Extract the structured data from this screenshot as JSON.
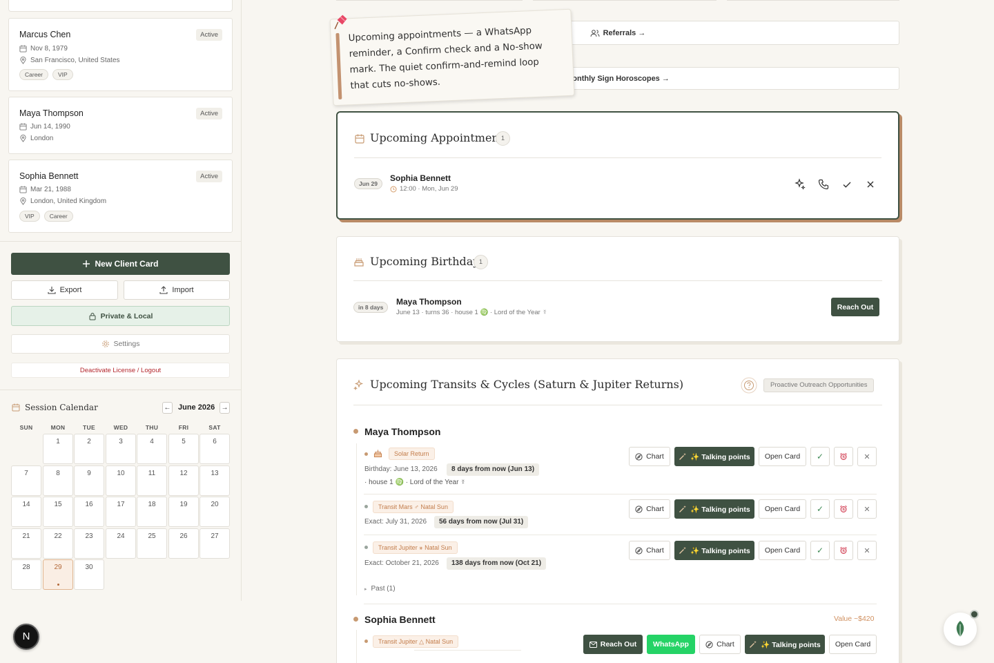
{
  "clients": [
    {
      "name": "Marcus Chen",
      "status": "Active",
      "date": "Nov 8, 1979",
      "location": "San Francisco, United States",
      "tags": [
        "Career",
        "VIP"
      ]
    },
    {
      "name": "Maya Thompson",
      "status": "Active",
      "date": "Jun 14, 1990",
      "location": "London",
      "tags": []
    },
    {
      "name": "Sophia Bennett",
      "status": "Active",
      "date": "Mar 21, 1988",
      "location": "London, United Kingdom",
      "tags": [
        "VIP",
        "Career"
      ]
    }
  ],
  "sidebar": {
    "new_client": "New Client Card",
    "export": "Export",
    "import": "Import",
    "private": "Private & Local",
    "settings": "Settings",
    "logout": "Deactivate License / Logout"
  },
  "calendar": {
    "title": "Session Calendar",
    "month": "June 2026",
    "prev": "←",
    "next": "→",
    "dow": [
      "SUN",
      "MON",
      "TUE",
      "WED",
      "THU",
      "FRI",
      "SAT"
    ],
    "today": "29",
    "days": [
      "1",
      "2",
      "3",
      "4",
      "5",
      "6",
      "7",
      "8",
      "9",
      "10",
      "11",
      "12",
      "13",
      "14",
      "15",
      "16",
      "17",
      "18",
      "19",
      "20",
      "21",
      "22",
      "23",
      "24",
      "25",
      "26",
      "27",
      "28",
      "29",
      "30"
    ]
  },
  "nextjs_badge": "N",
  "links": {
    "referrals": "Referrals →",
    "horoscopes": "Monthly Sign Horoscopes →"
  },
  "note": {
    "text": "Upcoming appointments — a WhatsApp reminder, a Confirm check and a No-show mark. The quiet confirm-and-remind loop that cuts no-shows."
  },
  "appointments": {
    "title": "Upcoming Appointments",
    "count": "1",
    "items": [
      {
        "date": "Jun 29",
        "name": "Sophia Bennett",
        "time": "12:00 · Mon, Jun 29"
      }
    ]
  },
  "birthdays": {
    "title": "Upcoming Birthdays",
    "count": "1",
    "items": [
      {
        "when": "in 8 days",
        "name": "Maya Thompson",
        "details": "June 13 · turns 36 · house 1 ♍ · Lord of the Year ☿",
        "action": "Reach Out"
      }
    ]
  },
  "transits": {
    "title": "Upcoming Transits & Cycles (Saturn & Jupiter Returns)",
    "badge": "Proactive Outreach Opportunities",
    "buttons": {
      "chart": "Chart",
      "talking": "✨ Talking points",
      "open": "Open Card",
      "check": "✓",
      "close": "✕",
      "reach": "Reach Out",
      "whatsapp": "WhatsApp"
    },
    "people": [
      {
        "name": "Maya Thompson",
        "events": [
          {
            "tag": "Solar Return",
            "text": "Birthday: June 13, 2026",
            "pill": "8 days from now (Jun 13)",
            "extra": "· house 1 ♍ · Lord of the Year ☿"
          },
          {
            "tag": "Transit Mars ♂ Natal Sun",
            "text": "Exact: July 31, 2026",
            "pill": "56 days from now (Jul 31)"
          },
          {
            "tag": "Transit Jupiter ⚹ Natal Sun",
            "text": "Exact: October 21, 2026",
            "pill": "138 days from now (Oct 21)"
          }
        ],
        "past": "Past (1)"
      },
      {
        "name": "Sophia Bennett",
        "value": "Value ~$420",
        "events": [
          {
            "tag": "Transit Jupiter △ Natal Sun"
          }
        ]
      }
    ]
  },
  "colors": {
    "accent": "#3f5142",
    "copper": "#c79a72",
    "whatsapp": "#25d366",
    "danger": "#b3262c",
    "background": "#f8f6f1"
  }
}
